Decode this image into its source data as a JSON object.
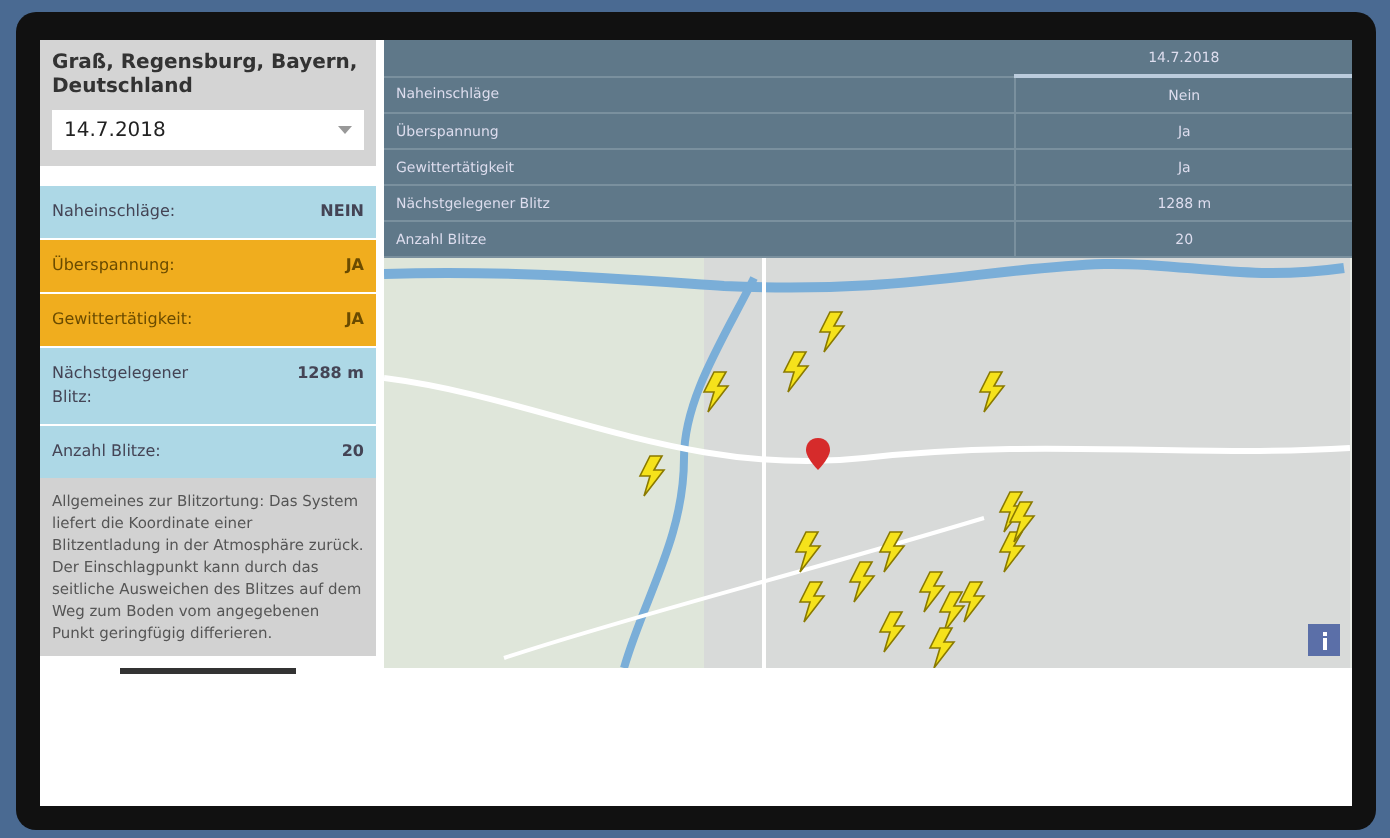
{
  "location": "Graß, Regensburg, Bayern, Deutschland",
  "date_select": {
    "value": "14.7.2018"
  },
  "summary": [
    {
      "label": "Naheinschläge:",
      "value": "NEIN",
      "alert": false
    },
    {
      "label": "Überspannung:",
      "value": "JA",
      "alert": true
    },
    {
      "label": "Gewittertätigkeit:",
      "value": "JA",
      "alert": true
    },
    {
      "label": "Nächstgelegener Blitz:",
      "value": "1288 m",
      "alert": false
    },
    {
      "label": "Anzahl Blitze:",
      "value": "20",
      "alert": false
    }
  ],
  "info_text": "Allgemeines zur Blitzortung: Das System liefert die Koordinate einer Blitzentladung in der Atmosphäre zurück. Der Einschlagpunkt kann durch das seitliche Ausweichen des Blitzes auf dem Weg zum Boden vom angegebenen Punkt geringfügig differieren.",
  "table": {
    "columns": [
      "14.7.2018"
    ],
    "rows": [
      {
        "label": "Naheinschläge",
        "value": "Nein"
      },
      {
        "label": "Überspannung",
        "value": "Ja"
      },
      {
        "label": "Gewittertätigkeit",
        "value": "Ja"
      },
      {
        "label": "Nächstgelegener Blitz",
        "value": "1288 m"
      },
      {
        "label": "Anzahl Blitze",
        "value": "20"
      }
    ]
  }
}
